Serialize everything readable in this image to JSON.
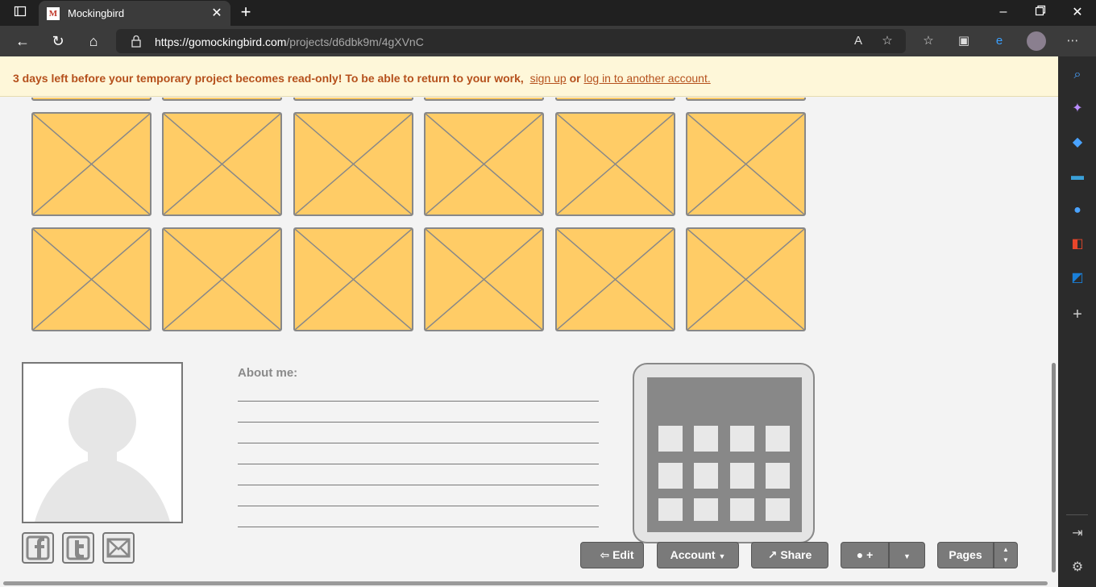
{
  "browser": {
    "tab_title": "Mockingbird",
    "tab_favicon": "M",
    "url_host": "https://gomockingbird.com",
    "url_path": "/projects/d6dbk9m/4gXVnC"
  },
  "banner": {
    "message": "3 days left before your temporary project becomes read-only! To be able to return to your work,",
    "signup_link": "sign up",
    "or_text": "or",
    "login_link": "log in to another account.",
    "text_color": "#b5501c",
    "background": "#fef7d9"
  },
  "profile": {
    "about_label": "About me:"
  },
  "toolbar": {
    "edit_label": "Edit",
    "account_label": "Account",
    "share_label": "Share",
    "comment_label": "+",
    "pages_label": "Pages"
  },
  "colors": {
    "placeholder_fill": "#ffcc66",
    "toolbar_button": "#7a7a7a"
  }
}
